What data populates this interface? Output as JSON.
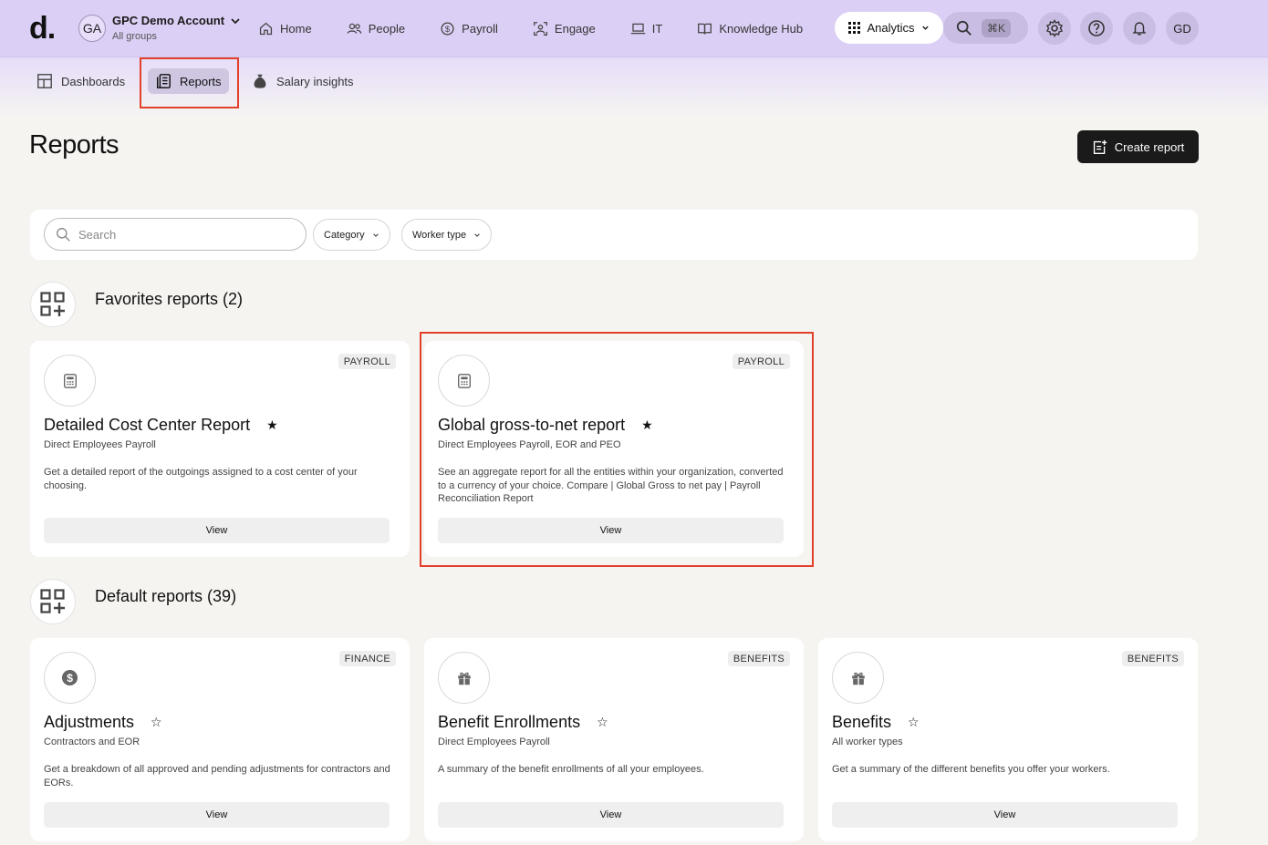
{
  "brand": {
    "logo_text": "d."
  },
  "account": {
    "initials": "GA",
    "name": "GPC Demo Account",
    "subtitle": "All groups"
  },
  "nav": {
    "items": [
      {
        "label": "Home",
        "icon": "home-icon"
      },
      {
        "label": "People",
        "icon": "people-icon"
      },
      {
        "label": "Payroll",
        "icon": "dollar-icon"
      },
      {
        "label": "Engage",
        "icon": "engage-icon"
      },
      {
        "label": "IT",
        "icon": "laptop-icon"
      },
      {
        "label": "Knowledge Hub",
        "icon": "book-icon"
      }
    ],
    "analytics_label": "Analytics",
    "search_shortcut": "⌘K",
    "user_initials": "GD"
  },
  "subnav": {
    "items": [
      {
        "label": "Dashboards",
        "icon": "dashboard-icon"
      },
      {
        "label": "Reports",
        "icon": "reports-icon",
        "active": true
      },
      {
        "label": "Salary insights",
        "icon": "money-bag-icon"
      }
    ]
  },
  "page": {
    "title": "Reports",
    "create_button": "Create report"
  },
  "filters": {
    "search_placeholder": "Search",
    "category_label": "Category",
    "worker_type_label": "Worker type"
  },
  "favorites": {
    "title": "Favorites reports (2)",
    "cards": [
      {
        "badge": "PAYROLL",
        "title": "Detailed Cost Center Report",
        "starred": true,
        "subtitle": "Direct Employees Payroll",
        "description": "Get a detailed report of the outgoings assigned to a cost center of your choosing.",
        "button": "View",
        "icon": "calculator-icon"
      },
      {
        "badge": "PAYROLL",
        "title": "Global gross-to-net report",
        "starred": true,
        "subtitle": "Direct Employees Payroll, EOR and PEO",
        "description": "See an aggregate report for all the entities within your organization, converted to a currency of your choice. Compare | Global Gross to net pay | Payroll Reconciliation Report",
        "button": "View",
        "icon": "calculator-icon"
      }
    ]
  },
  "defaults": {
    "title": "Default reports (39)",
    "cards": [
      {
        "badge": "FINANCE",
        "title": "Adjustments",
        "starred": false,
        "subtitle": "Contractors and EOR",
        "description": "Get a breakdown of all approved and pending adjustments for contractors and EORs.",
        "button": "View",
        "icon": "dollar-coin-icon"
      },
      {
        "badge": "BENEFITS",
        "title": "Benefit Enrollments",
        "starred": false,
        "subtitle": "Direct Employees Payroll",
        "description": "A summary of the benefit enrollments of all your employees.",
        "button": "View",
        "icon": "gift-icon"
      },
      {
        "badge": "BENEFITS",
        "title": "Benefits",
        "starred": false,
        "subtitle": "All worker types",
        "description": "Get a summary of the different benefits you offer your workers.",
        "button": "View",
        "icon": "gift-icon"
      }
    ]
  },
  "glyphs": {
    "star_filled": "★",
    "star_empty": "☆"
  },
  "colors": {
    "topbar": "#dccff5",
    "highlight": "#e2402b",
    "primary_button": "#1a1a1a"
  }
}
